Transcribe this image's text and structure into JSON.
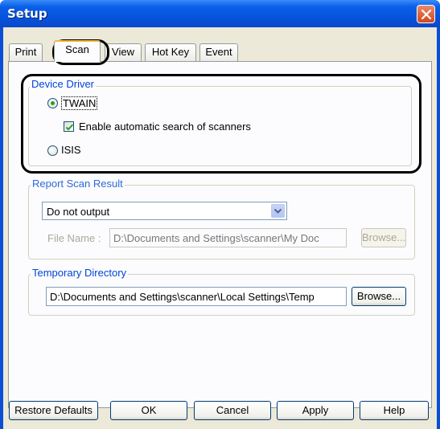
{
  "window": {
    "title": "Setup",
    "close_icon": "close-icon"
  },
  "tabs": [
    {
      "label": "Print",
      "active": false
    },
    {
      "label": "Scan",
      "active": true
    },
    {
      "label": "View",
      "active": false
    },
    {
      "label": "Hot Key",
      "active": false
    },
    {
      "label": "Event",
      "active": false
    }
  ],
  "device_driver": {
    "legend": "Device Driver",
    "twain": {
      "label": "TWAIN",
      "selected": true
    },
    "auto_search": {
      "label": "Enable automatic search of scanners",
      "checked": true
    },
    "isis": {
      "label": "ISIS",
      "selected": false
    }
  },
  "report_scan_result": {
    "legend": "Report Scan Result",
    "output_select": {
      "value": "Do not output"
    },
    "file_name": {
      "label": "File Name :",
      "value": "D:\\Documents and Settings\\scanner\\My Doc"
    },
    "browse_label": "Browse..."
  },
  "temporary_directory": {
    "legend": "Temporary Directory",
    "path": "D:\\Documents and Settings\\scanner\\Local Settings\\Temp",
    "browse_label": "Browse..."
  },
  "footer_buttons": {
    "restore_defaults": "Restore Defaults",
    "ok": "OK",
    "cancel": "Cancel",
    "apply": "Apply",
    "help": "Help"
  },
  "colors": {
    "title_bar": "#0a5fe8",
    "dialog_background": "#ece9d8",
    "group_legend": "#0046d5",
    "highlight_frame": "#000000"
  }
}
